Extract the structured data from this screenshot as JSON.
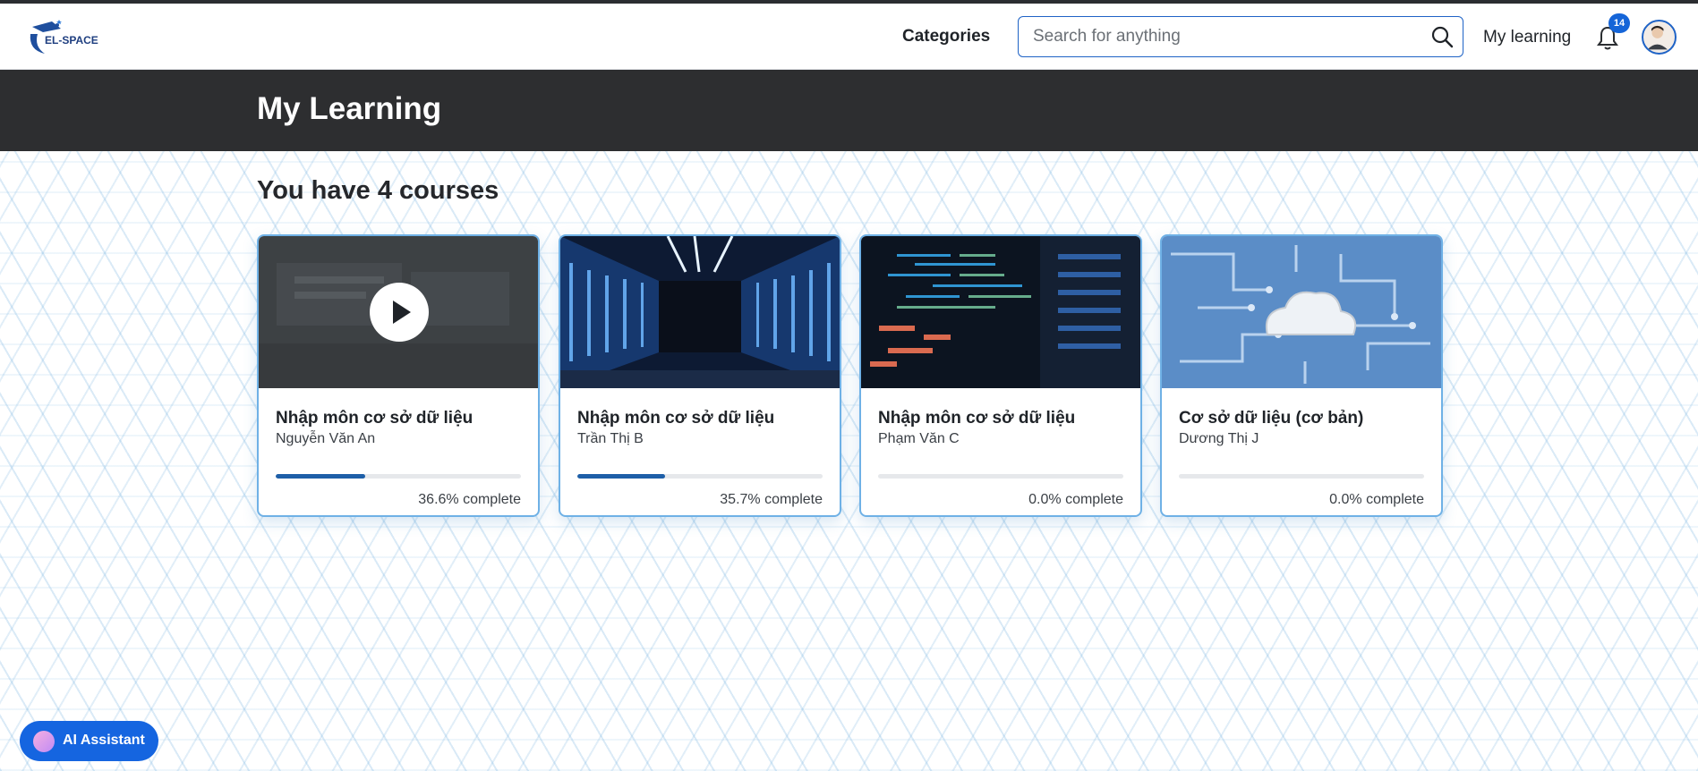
{
  "brand": {
    "logo_text": "EL-SPACE"
  },
  "header": {
    "categories_label": "Categories",
    "search_placeholder": "Search for anything",
    "my_learning_label": "My learning",
    "notification_count": "14"
  },
  "banner": {
    "title": "My Learning"
  },
  "main": {
    "count_title": "You have 4 courses",
    "courses": [
      {
        "title": "Nhập môn cơ sở dữ liệu",
        "author": "Nguyễn Văn An",
        "progress": 36.6,
        "progress_text": "36.6% complete",
        "thumbnail": "video-preview-with-play-icon"
      },
      {
        "title": "Nhập môn cơ sở dữ liệu",
        "author": "Trần Thị B",
        "progress": 35.7,
        "progress_text": "35.7% complete",
        "thumbnail": "server-room-corridor"
      },
      {
        "title": "Nhập môn cơ sở dữ liệu",
        "author": "Phạm Văn C",
        "progress": 0.0,
        "progress_text": "0.0% complete",
        "thumbnail": "server-rack-with-code"
      },
      {
        "title": "Cơ sở dữ liệu (cơ bản)",
        "author": "Dương Thị J",
        "progress": 0.0,
        "progress_text": "0.0% complete",
        "thumbnail": "cloud-on-circuit-board"
      }
    ]
  },
  "assistant": {
    "label": "AI Assistant"
  },
  "colors": {
    "accent": "#1565e0",
    "banner": "#2d2e30",
    "progress": "#1e5fa8",
    "card_border": "#6fb1e6"
  }
}
